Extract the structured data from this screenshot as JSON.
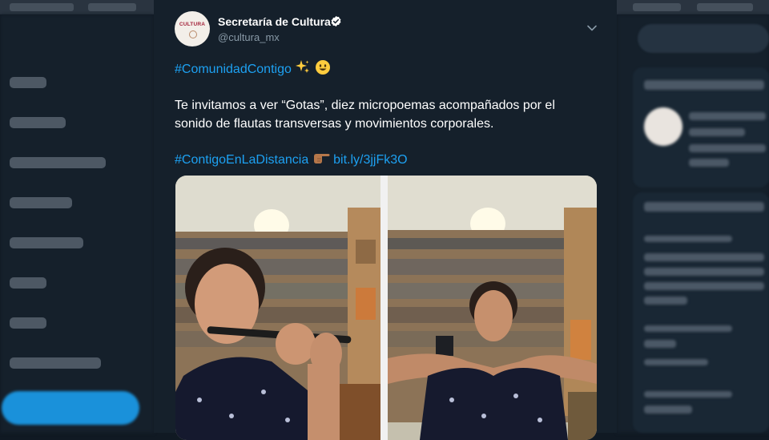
{
  "tweet": {
    "author_name": "Secretaría de Cultura",
    "author_handle": "@cultura_mx",
    "avatar_logo_text": "CULTURA",
    "line1_hashtag": "#ComunidadContigo",
    "body_line1": "Te invitamos a ver “Gotas”, diez micropoemas acompañados por el",
    "body_line2": "sonido de flautas transversas y movimientos corporales.",
    "line3_hashtag": "#ContigoEnLaDistancia",
    "link_text": "bit.ly/3jjFk3O"
  },
  "icons": {
    "verified": "verified-badge-icon",
    "caret": "chevron-down-icon",
    "sparkles": "sparkles-emoji",
    "smile": "smile-emoji",
    "pointing_hand": "pointing-right-emoji"
  },
  "colors": {
    "background": "#15202b",
    "link": "#1da1f2",
    "secondary_text": "#8899a6",
    "text": "#ffffff"
  }
}
